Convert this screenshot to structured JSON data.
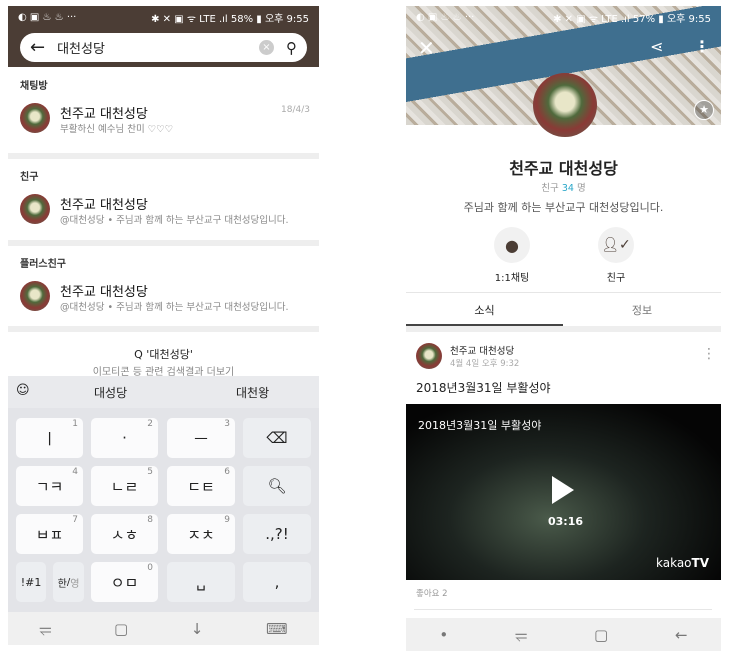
{
  "left": {
    "status": {
      "left_icons": "◐ ▣ ♨ ♨ ···",
      "right": "✱ ✕ ▣ ᯤ LTE .ıl 58% ▮ 오후 9:55"
    },
    "search": {
      "value": "대천성당",
      "back_icon": "arrow-left-icon",
      "clear_icon": "clear-icon",
      "search_icon": "search-icon"
    },
    "sections": [
      {
        "title": "채팅방",
        "item": {
          "name": "천주교 대천성당",
          "sub": "부활하신 예수님 찬미 ♡♡♡",
          "date": "18/4/3"
        }
      },
      {
        "title": "친구",
        "item": {
          "name": "천주교 대천성당",
          "sub": "@대천성당 • 주님과 함께 하는 부산교구 대천성당입니다."
        }
      },
      {
        "title": "플러스친구",
        "item": {
          "name": "천주교 대천성당",
          "sub": "@대천성당 • 주님과 함께 하는 부산교구 대천성당입니다."
        }
      }
    ],
    "more": {
      "query": "Q '대천성당'",
      "sub": "이모티콘 등 관련 검색결과 더보기"
    },
    "keyboard": {
      "suggestions": [
        "대성당",
        "대천왕"
      ],
      "keys": [
        {
          "label": "ㅣ",
          "num": "1"
        },
        {
          "label": "·",
          "num": "2"
        },
        {
          "label": "ㅡ",
          "num": "3"
        },
        {
          "label": "⌫",
          "num": ""
        },
        {
          "label": "ㄱㅋ",
          "num": "4"
        },
        {
          "label": "ㄴㄹ",
          "num": "5"
        },
        {
          "label": "ㄷㅌ",
          "num": "6"
        },
        {
          "label": "🔍︎",
          "num": ""
        },
        {
          "label": "ㅂㅍ",
          "num": "7"
        },
        {
          "label": "ㅅㅎ",
          "num": "8"
        },
        {
          "label": "ㅈㅊ",
          "num": "9"
        },
        {
          "label": ".,?!",
          "num": ""
        }
      ],
      "row4": {
        "sym": "!#1",
        "lang_top": "한",
        "lang_bottom": "영",
        "zero": "ㅇㅁ",
        "zero_num": "0",
        "space": "␣",
        "comma": ","
      }
    },
    "nav": [
      "⥫",
      "▢",
      "↓",
      "⌨"
    ]
  },
  "right": {
    "status": {
      "left_icons": "◐ ▣ ♨ ♨ ···",
      "right": "✱ ✕ ▣ ᯤ LTE .ıl 57% ▮ 오후 9:55"
    },
    "profile": {
      "name": "천주교 대천성당",
      "friends_prefix": "친구",
      "friends_count": "34",
      "friends_suffix": "명",
      "desc": "주님과 함께 하는 부산교구 대천성당입니다."
    },
    "actions": [
      {
        "label": "1:1채팅",
        "icon": "chat-bubble-icon"
      },
      {
        "label": "친구",
        "icon": "friend-check-icon"
      }
    ],
    "tabs": [
      {
        "label": "소식",
        "active": true
      },
      {
        "label": "정보",
        "active": false
      }
    ],
    "post": {
      "author": "천주교 대천성당",
      "time": "4월 4일 오후 9:32",
      "title": "2018년3월31일 부활성야",
      "video_title": "2018년3월31일 부활성야",
      "duration": "03:16",
      "brand": "kakao",
      "brand_bold": "TV",
      "likes": "좋아요 2"
    },
    "nav": [
      "•",
      "⥫",
      "▢",
      "←"
    ],
    "accent": "#2aa7c9"
  }
}
